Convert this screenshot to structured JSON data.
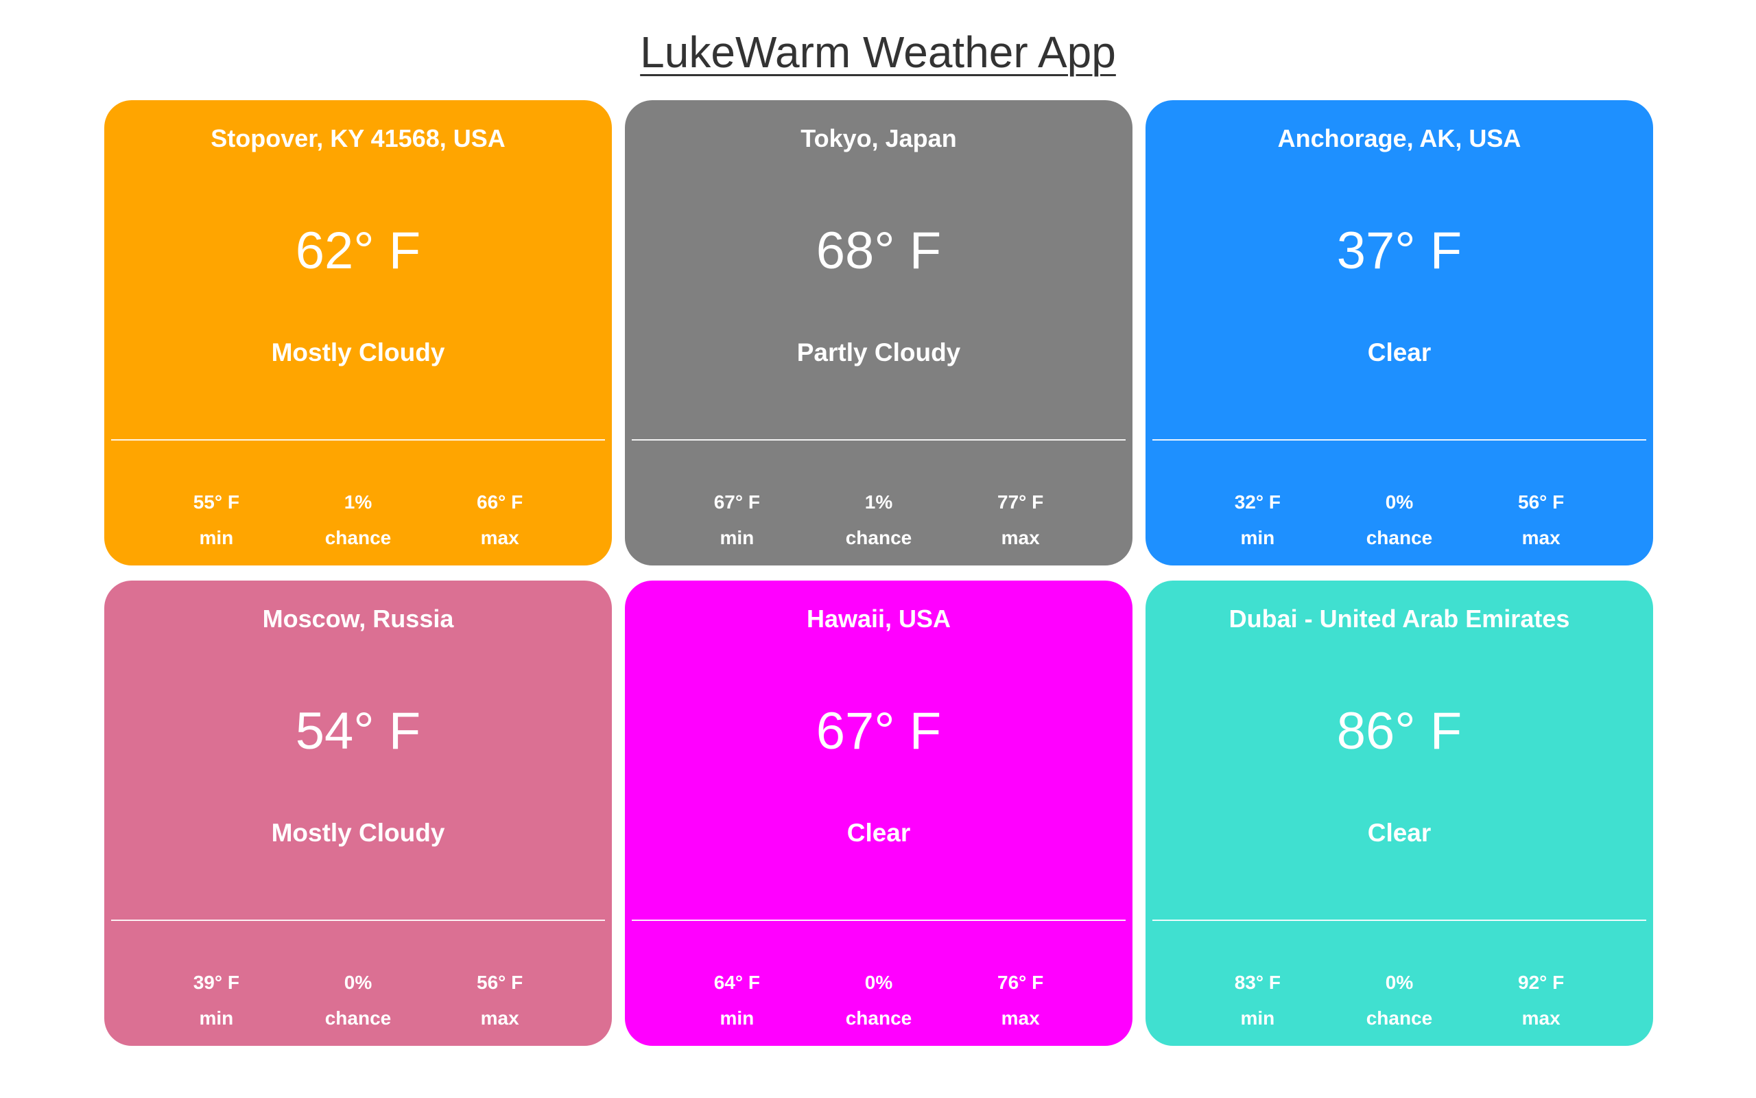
{
  "app": {
    "title": "LukeWarm Weather App"
  },
  "cards": [
    {
      "location": "Stopover, KY 41568, USA",
      "temp": "62° F",
      "condition": "Mostly Cloudy",
      "color": "#FFA500",
      "min": "55° F",
      "min_label": "min",
      "chance": "1%",
      "chance_label": "chance",
      "max": "66° F",
      "max_label": "max"
    },
    {
      "location": "Tokyo, Japan",
      "temp": "68° F",
      "condition": "Partly Cloudy",
      "color": "#808080",
      "min": "67° F",
      "min_label": "min",
      "chance": "1%",
      "chance_label": "chance",
      "max": "77° F",
      "max_label": "max"
    },
    {
      "location": "Anchorage, AK, USA",
      "temp": "37° F",
      "condition": "Clear",
      "color": "#1E90FF",
      "min": "32° F",
      "min_label": "min",
      "chance": "0%",
      "chance_label": "chance",
      "max": "56° F",
      "max_label": "max"
    },
    {
      "location": "Moscow, Russia",
      "temp": "54° F",
      "condition": "Mostly Cloudy",
      "color": "#DB7093",
      "min": "39° F",
      "min_label": "min",
      "chance": "0%",
      "chance_label": "chance",
      "max": "56° F",
      "max_label": "max"
    },
    {
      "location": "Hawaii, USA",
      "temp": "67° F",
      "condition": "Clear",
      "color": "#FF00FF",
      "min": "64° F",
      "min_label": "min",
      "chance": "0%",
      "chance_label": "chance",
      "max": "76° F",
      "max_label": "max"
    },
    {
      "location": "Dubai - United Arab Emirates",
      "temp": "86° F",
      "condition": "Clear",
      "color": "#40E0D0",
      "min": "83° F",
      "min_label": "min",
      "chance": "0%",
      "chance_label": "chance",
      "max": "92° F",
      "max_label": "max"
    }
  ]
}
